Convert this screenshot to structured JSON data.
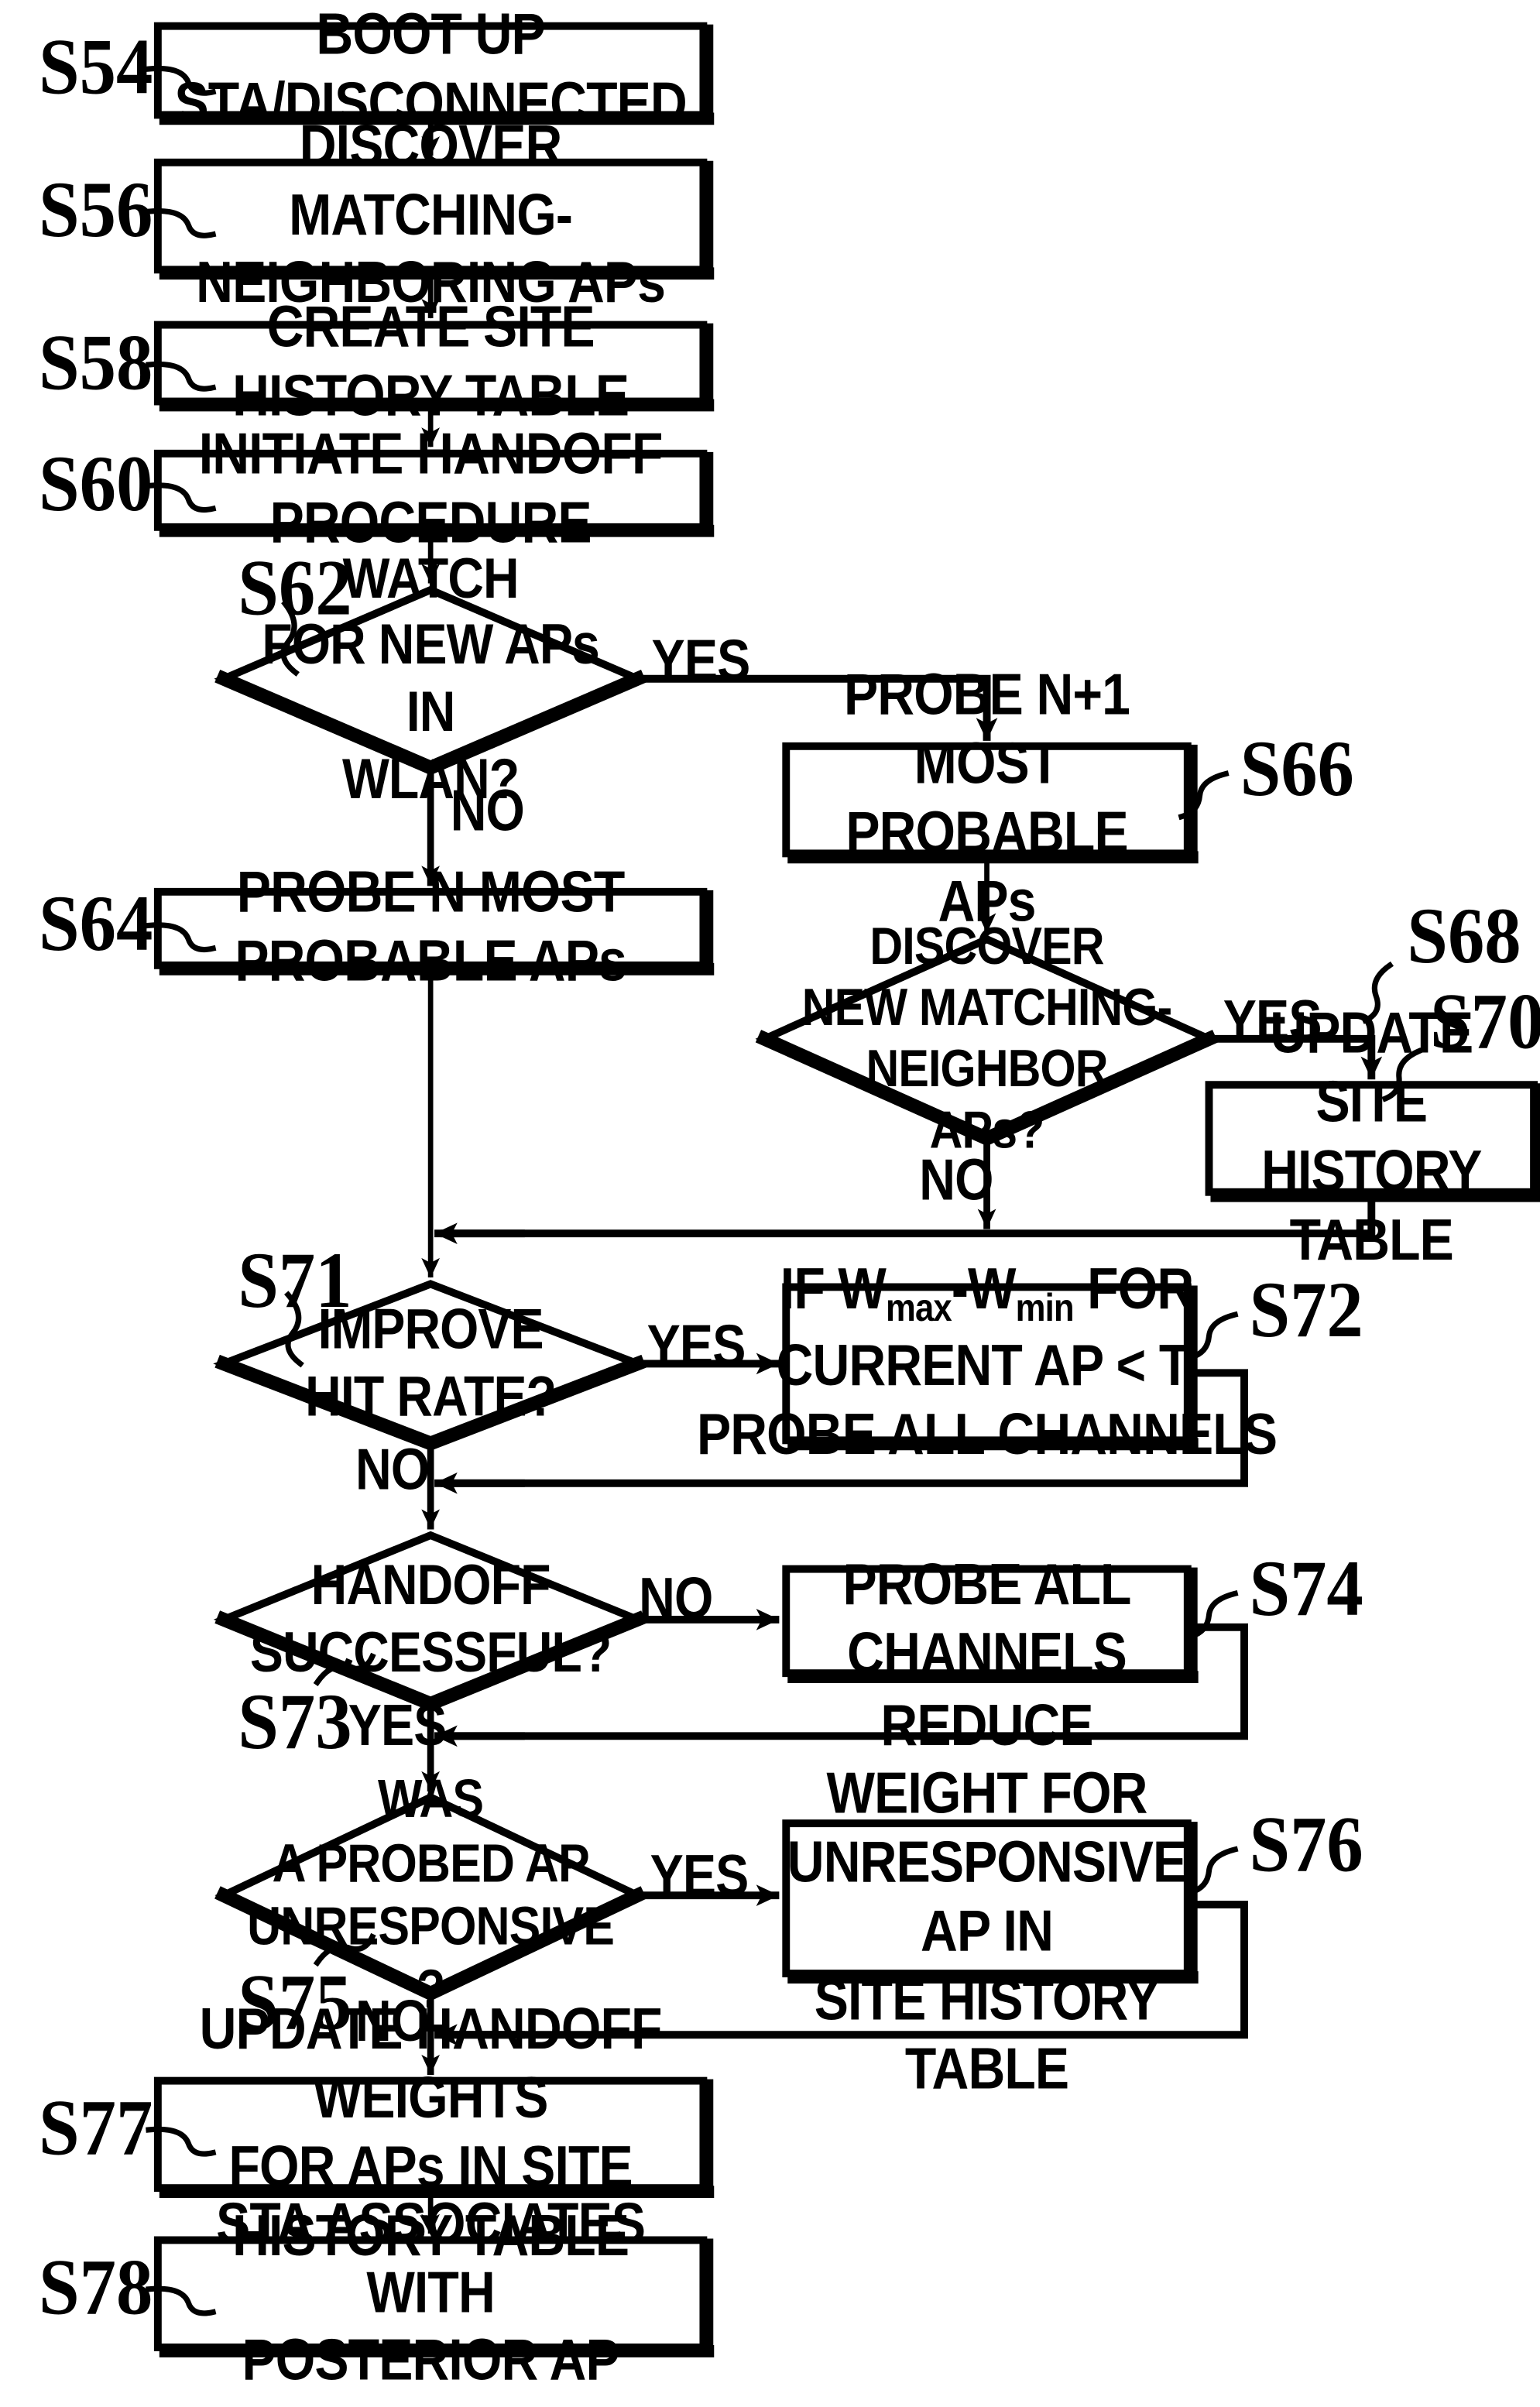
{
  "figure": {
    "kind": "flowchart",
    "orientation": "vertical"
  },
  "nodes": [
    {
      "id": "S54",
      "tag": "S54",
      "shape": "process",
      "text": "BOOT UP STA/DISCONNECTED"
    },
    {
      "id": "S56",
      "tag": "S56",
      "shape": "process",
      "text": "DISCOVER\nMATCHING-NEIGHBORING APs"
    },
    {
      "id": "S58",
      "tag": "S58",
      "shape": "process",
      "text": "CREATE SITE HISTORY TABLE"
    },
    {
      "id": "S60",
      "tag": "S60",
      "shape": "process",
      "text": "INITIATE HANDOFF PROCEDURE"
    },
    {
      "id": "S62",
      "tag": "S62",
      "shape": "decision",
      "text": "WATCH\nFOR NEW APs IN\nWLAN?"
    },
    {
      "id": "S64",
      "tag": "S64",
      "shape": "process",
      "text": "PROBE N MOST PROBABLE APs"
    },
    {
      "id": "S66",
      "tag": "S66",
      "shape": "process",
      "text": "PROBE N+1 MOST\nPROBABLE APs"
    },
    {
      "id": "S68",
      "tag": "S68",
      "shape": "decision",
      "text": "DISCOVER\nNEW MATCHING-\nNEIGHBOR\nAPs?"
    },
    {
      "id": "S70",
      "tag": "S70",
      "shape": "process",
      "text": "UPDATE SITE\nHISTORY TABLE"
    },
    {
      "id": "S71",
      "tag": "S71",
      "shape": "decision",
      "text": "IMPROVE\nHIT RATE?"
    },
    {
      "id": "S72",
      "tag": "S72",
      "shape": "process",
      "text": "IF Wmax -Wmin  FOR\nCURRENT AP < T,\nPROBE ALL CHANNELS",
      "lines": [
        "IF W",
        "max",
        " -W",
        "min",
        "  FOR",
        "CURRENT AP < T,",
        "PROBE ALL CHANNELS"
      ]
    },
    {
      "id": "S73",
      "tag": "S73",
      "shape": "decision",
      "text": "HANDOFF\nSUCCESSFUL?"
    },
    {
      "id": "S74",
      "tag": "S74",
      "shape": "process",
      "text": "PROBE ALL CHANNELS"
    },
    {
      "id": "S75",
      "tag": "S75",
      "shape": "decision",
      "text": "WAS\nA PROBED AP\nUNRESPONSIVE\n?"
    },
    {
      "id": "S76",
      "tag": "S76",
      "shape": "process",
      "text": "REDUCE WEIGHT FOR\nUNRESPONSIVE AP IN\nSITE HISTORY TABLE"
    },
    {
      "id": "S77",
      "tag": "S77",
      "shape": "process",
      "text": "UPDATE HANDOFF WEIGHTS\nFOR APs IN SITE HISTORY TABLE"
    },
    {
      "id": "S78",
      "tag": "S78",
      "shape": "process",
      "text": "STA ASSOCIATES WITH\nPOSTERIOR AP"
    }
  ],
  "edge_labels": {
    "s62_yes": "YES",
    "s62_no": "NO",
    "s68_yes": "YES",
    "s68_no": "NO",
    "s71_yes": "YES",
    "s71_no": "NO",
    "s73_no": "NO",
    "s73_yes": "YES",
    "s75_yes": "YES",
    "s75_no": "NO"
  },
  "math": {
    "s72_prefix": "IF W",
    "s72_sub_max": "max",
    "s72_mid": "-W",
    "s72_sub_min": "min",
    "s72_suffix": "FOR",
    "s72_line2": "CURRENT AP < T,",
    "s72_line3": "PROBE ALL CHANNELS"
  },
  "colors": {
    "ink": "#000000",
    "paper": "#ffffff"
  }
}
